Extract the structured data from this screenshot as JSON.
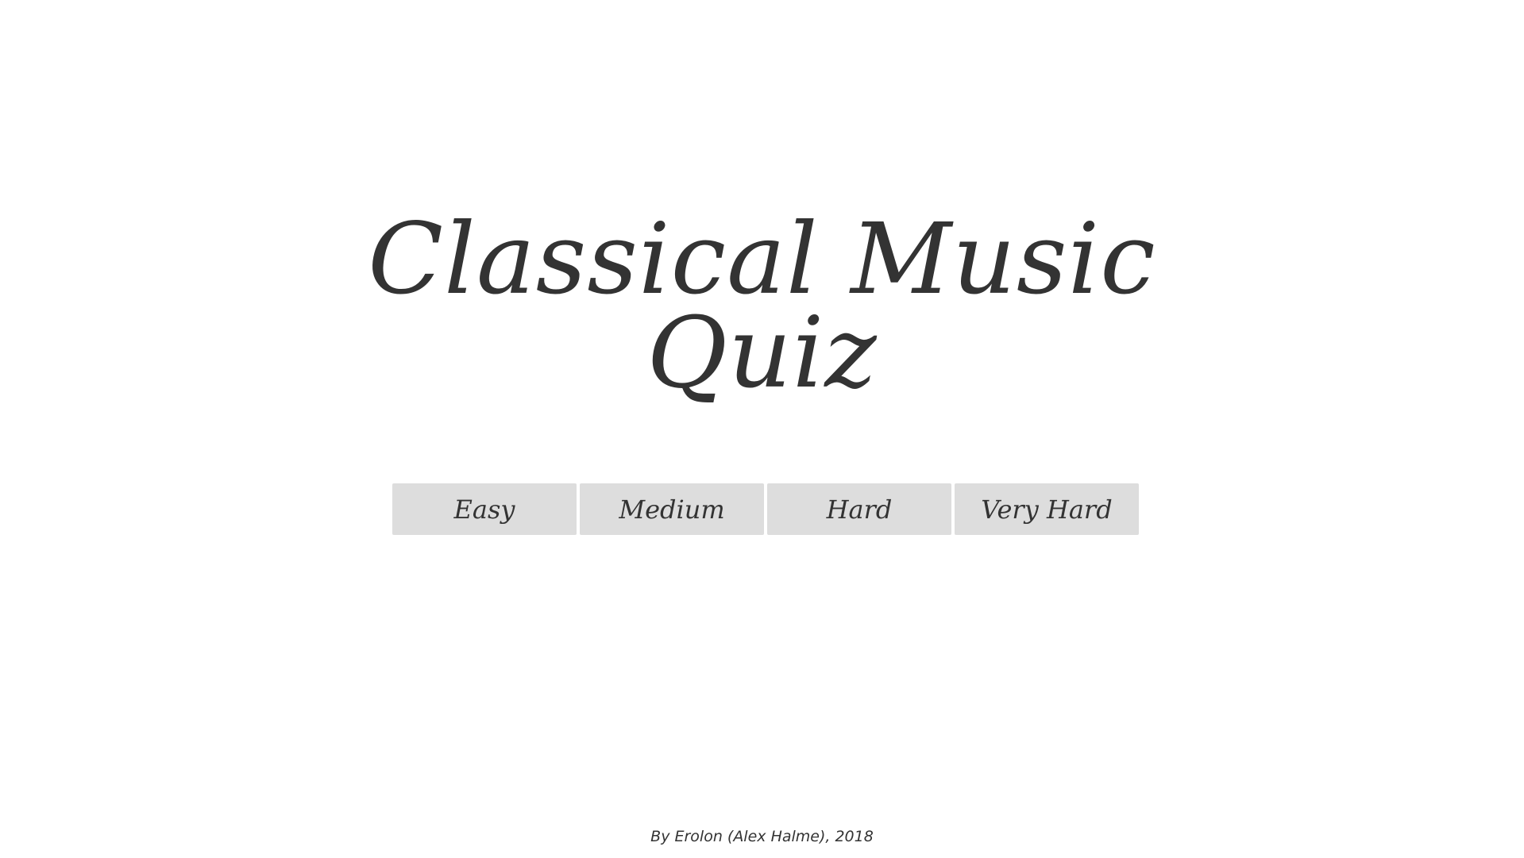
{
  "title": {
    "line1": "Classical Music",
    "line2": "Quiz"
  },
  "difficulties": [
    {
      "label": "Easy"
    },
    {
      "label": "Medium"
    },
    {
      "label": "Hard"
    },
    {
      "label": "Very Hard"
    }
  ],
  "footer": {
    "credit": "By Erolon (Alex Halme), 2018"
  },
  "colors": {
    "background": "#ffffff",
    "text": "#333333",
    "button_background": "#dddddd"
  }
}
